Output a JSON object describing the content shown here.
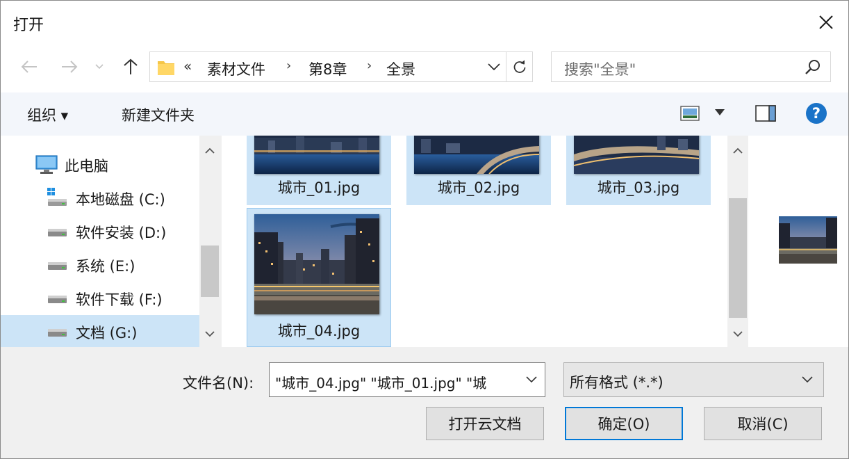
{
  "window": {
    "title": "打开"
  },
  "address": {
    "overflow": "«",
    "crumbs": [
      "素材文件",
      "第8章",
      "全景"
    ]
  },
  "search": {
    "placeholder": "搜索\"全景\""
  },
  "toolbar": {
    "organize": "组织 ▾",
    "new_folder": "新建文件夹"
  },
  "nav": {
    "items": [
      {
        "label": "此电脑",
        "icon": "computer-icon"
      },
      {
        "label": "本地磁盘 (C:)",
        "icon": "windows-drive-icon"
      },
      {
        "label": "软件安装 (D:)",
        "icon": "drive-icon"
      },
      {
        "label": "系统 (E:)",
        "icon": "drive-icon"
      },
      {
        "label": "软件下载 (F:)",
        "icon": "drive-icon"
      },
      {
        "label": "文档 (G:)",
        "icon": "drive-icon"
      }
    ],
    "selected_index": 5
  },
  "files": [
    {
      "name": "城市_01.jpg",
      "selected": true
    },
    {
      "name": "城市_02.jpg",
      "selected": true
    },
    {
      "name": "城市_03.jpg",
      "selected": true
    },
    {
      "name": "城市_04.jpg",
      "selected": true,
      "focused": true
    }
  ],
  "bottom": {
    "filename_label": "文件名(N):",
    "filename_value": "\"城市_04.jpg\" \"城市_01.jpg\" \"城",
    "filter_value": "所有格式 (*.*)",
    "cloud_button": "打开云文档",
    "ok_button": "确定(O)",
    "cancel_button": "取消(C)"
  },
  "colors": {
    "selection": "#cce4f7",
    "accent": "#0078d7",
    "help": "#1a73c8"
  }
}
